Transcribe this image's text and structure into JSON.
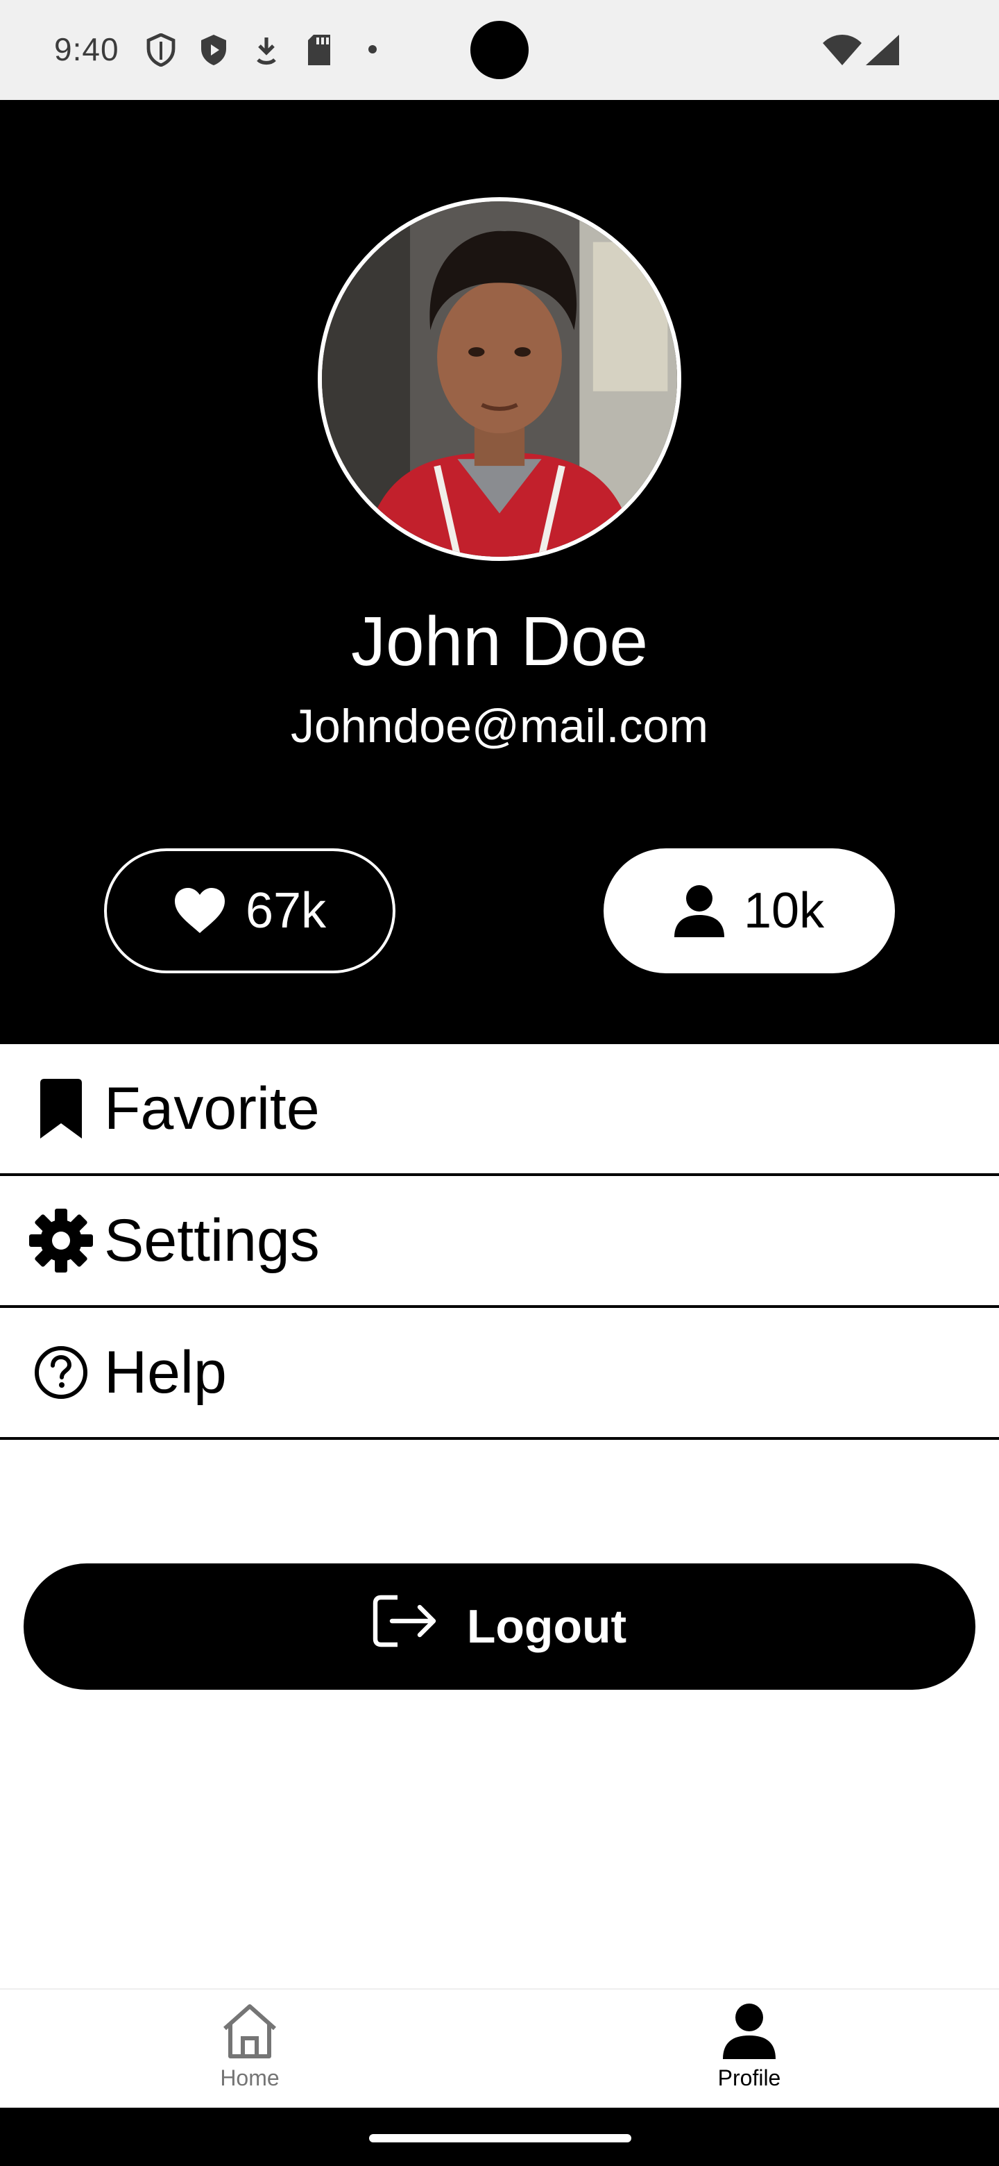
{
  "status_bar": {
    "time": "9:40"
  },
  "profile": {
    "name": "John Doe",
    "email": "Johndoe@mail.com",
    "stats": {
      "likes": "67k",
      "followers": "10k"
    }
  },
  "menu": {
    "items": [
      {
        "label": "Favorite",
        "icon": "bookmark-icon"
      },
      {
        "label": "Settings",
        "icon": "gear-icon"
      },
      {
        "label": "Help",
        "icon": "help-circle-icon"
      }
    ]
  },
  "logout": {
    "label": "Logout",
    "icon": "logout-icon"
  },
  "bottom_nav": {
    "items": [
      {
        "label": "Home",
        "icon": "home-icon",
        "active": false
      },
      {
        "label": "Profile",
        "icon": "person-icon",
        "active": true
      }
    ]
  },
  "colors": {
    "header_background": "#000000",
    "active_nav": "#000000",
    "inactive_nav": "#757575"
  }
}
